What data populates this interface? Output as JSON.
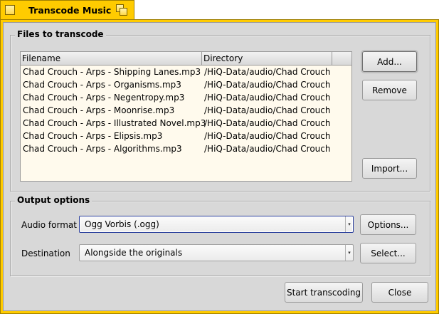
{
  "window": {
    "title": "Transcode Music"
  },
  "files_group": {
    "label": "Files to transcode",
    "columns": [
      "Filename",
      "Directory"
    ],
    "rows": [
      {
        "filename": "Chad Crouch - Arps  - Shipping Lanes.mp3",
        "directory": "/HiQ-Data/audio/Chad Crouch"
      },
      {
        "filename": "Chad Crouch - Arps  - Organisms.mp3",
        "directory": "/HiQ-Data/audio/Chad Crouch"
      },
      {
        "filename": "Chad Crouch - Arps  - Negentropy.mp3",
        "directory": "/HiQ-Data/audio/Chad Crouch"
      },
      {
        "filename": "Chad Crouch - Arps  - Moonrise.mp3",
        "directory": "/HiQ-Data/audio/Chad Crouch"
      },
      {
        "filename": "Chad Crouch - Arps  - Illustrated Novel.mp3",
        "directory": "/HiQ-Data/audio/Chad Crouch"
      },
      {
        "filename": "Chad Crouch - Arps  - Elipsis.mp3",
        "directory": "/HiQ-Data/audio/Chad Crouch"
      },
      {
        "filename": "Chad Crouch - Arps  - Algorithms.mp3",
        "directory": "/HiQ-Data/audio/Chad Crouch"
      }
    ],
    "add_label": "Add...",
    "remove_label": "Remove",
    "import_label": "Import..."
  },
  "output_group": {
    "label": "Output options",
    "audio_format_label": "Audio format",
    "audio_format_value": "Ogg Vorbis (.ogg)",
    "options_label": "Options...",
    "destination_label": "Destination",
    "destination_value": "Alongside the originals",
    "select_label": "Select..."
  },
  "footer": {
    "start_label": "Start transcoding",
    "close_label": "Close"
  },
  "colors": {
    "tab": "#ffcb00",
    "panel": "#d8d8d8",
    "list_background": "#fffaed",
    "focus": "#2a3e9c"
  }
}
